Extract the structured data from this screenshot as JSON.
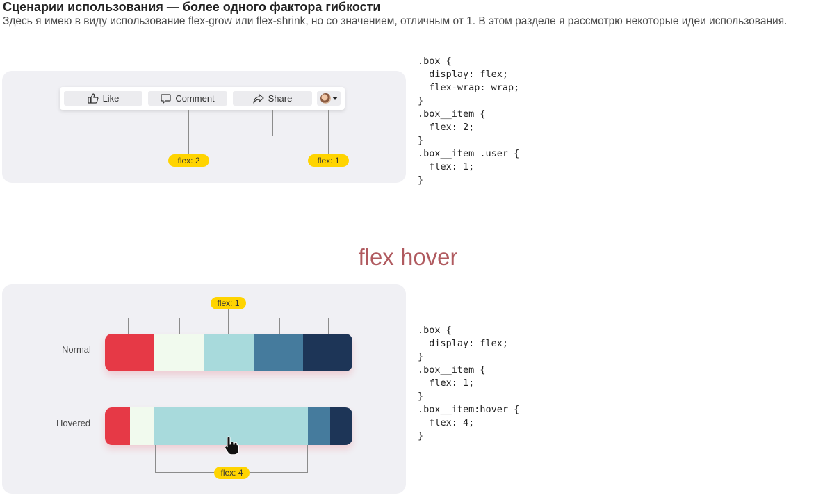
{
  "header": {
    "title": "Сценарии использования — более одного фактора гибкости",
    "description": "Здесь я имею в виду использование flex-grow или flex-shrink, но со значением, отличным от 1. В этом разделе я рассмотрю некоторые идеи использования."
  },
  "example1": {
    "buttons": [
      {
        "label": "Like",
        "icon": "thumbs-up-icon"
      },
      {
        "label": "Comment",
        "icon": "comment-icon"
      },
      {
        "label": "Share",
        "icon": "share-icon"
      }
    ],
    "user_button": {
      "icon": "avatar-icon",
      "caret": "caret-down-icon"
    },
    "pill_left": "flex: 2",
    "pill_right": "flex: 1",
    "code": ".box {\n  display: flex;\n  flex-wrap: wrap;\n}\n.box__item {\n  flex: 2;\n}\n.box__item .user {\n  flex: 1;\n}"
  },
  "section_heading": "flex hover",
  "example2": {
    "label_normal": "Normal",
    "label_hovered": "Hovered",
    "pill_top": "flex: 1",
    "pill_bottom": "flex: 4",
    "colors": [
      "#e63946",
      "#f1faee",
      "#a8dadc",
      "#457b9d",
      "#1d3557"
    ],
    "normal_flex": [
      1,
      1,
      1,
      1,
      1
    ],
    "hovered_flex": [
      0.5,
      0.5,
      3.1,
      0.45,
      0.45
    ],
    "cursor_icon": "hand-pointer-icon",
    "code": ".box {\n  display: flex;\n}\n.box__item {\n  flex: 1;\n}\n.box__item:hover {\n  flex: 4;\n}"
  }
}
